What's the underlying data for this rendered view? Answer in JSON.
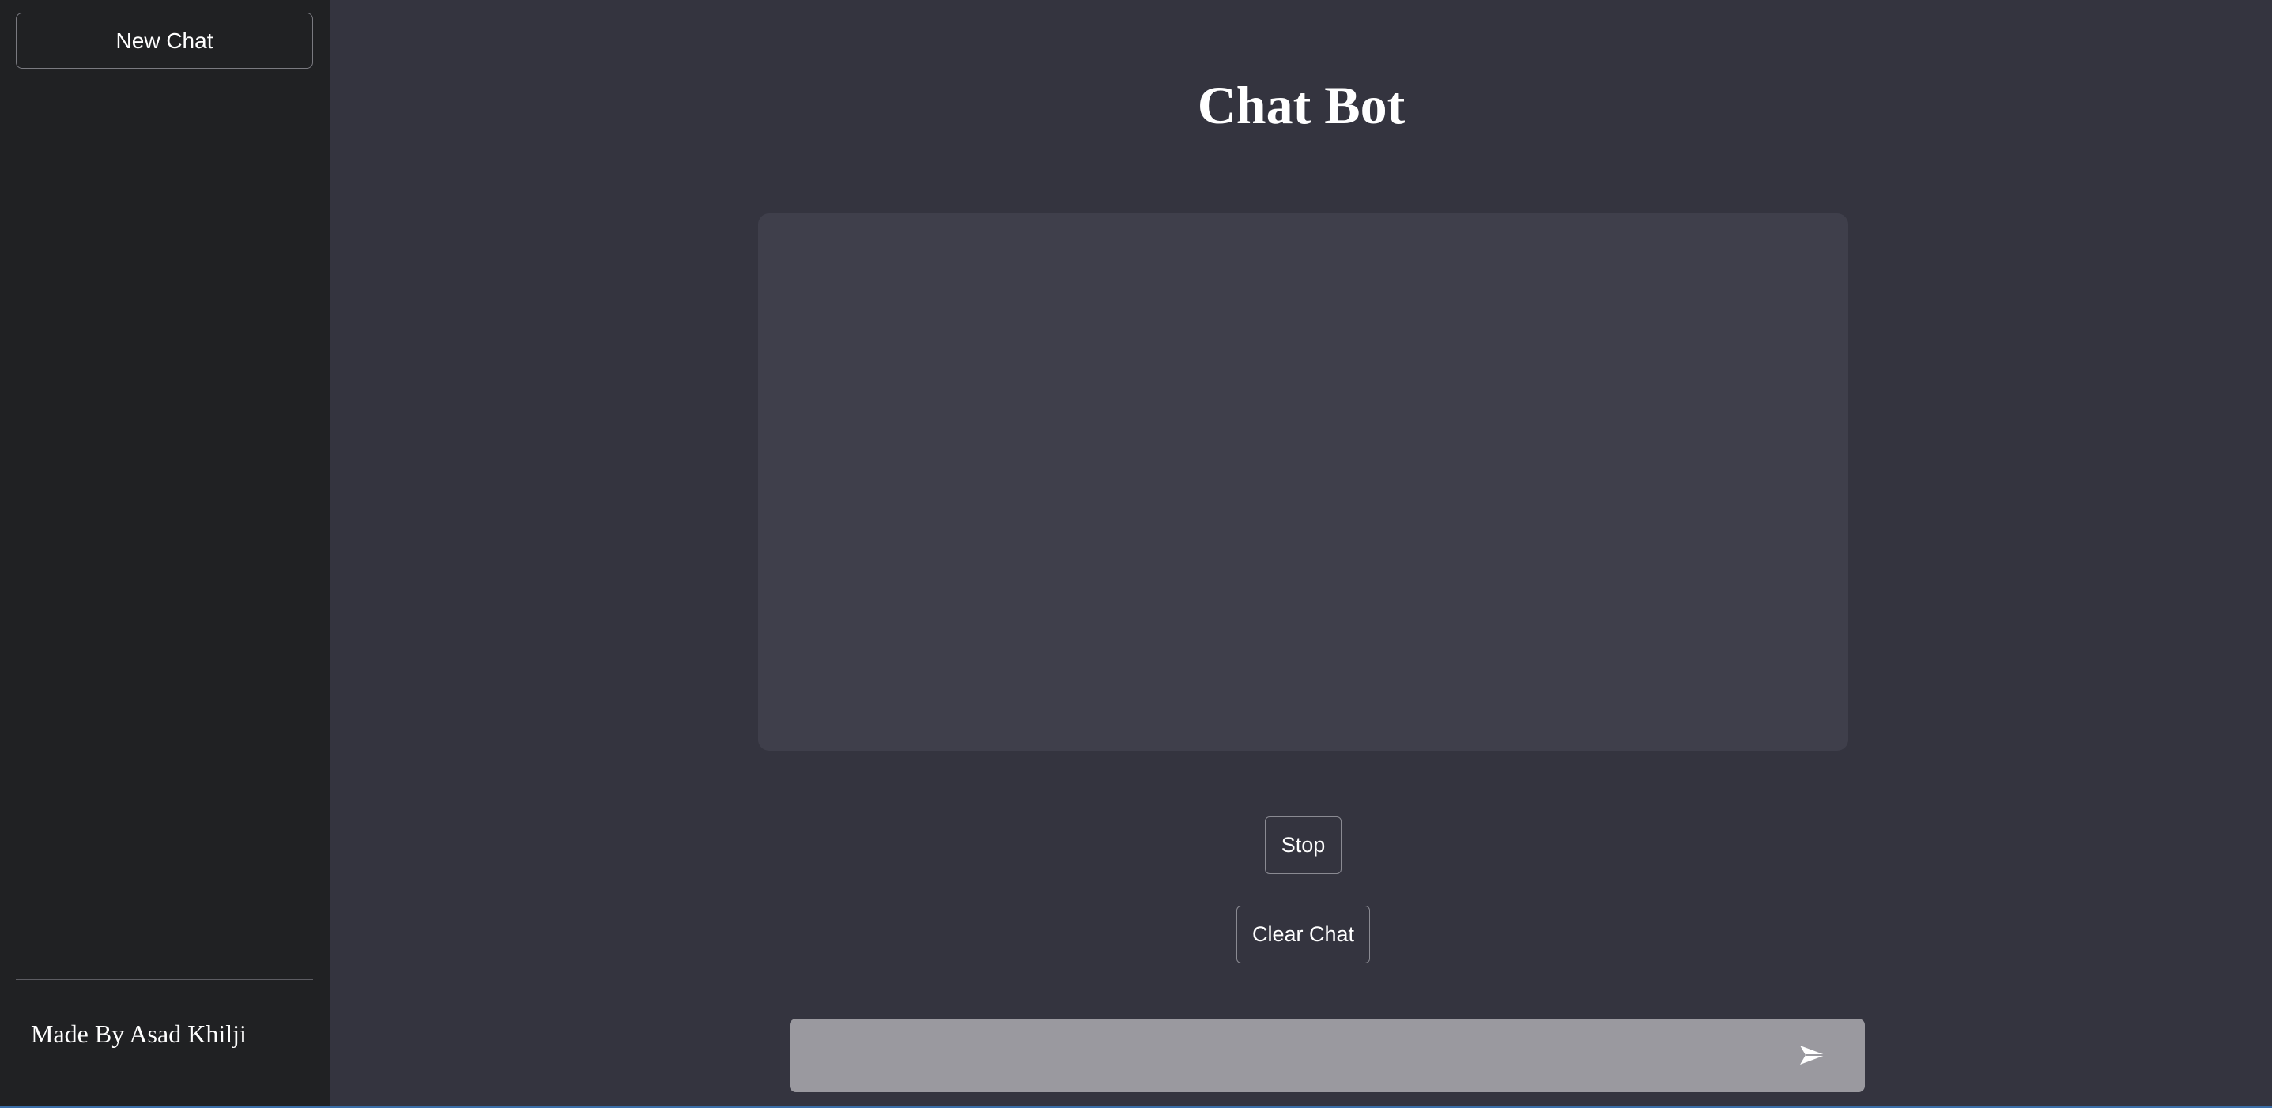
{
  "sidebar": {
    "new_chat_label": "New Chat",
    "credit": "Made By Asad Khilji"
  },
  "main": {
    "title": "Chat Bot",
    "stop_label": "Stop",
    "clear_label": "Clear Chat",
    "input": {
      "value": "",
      "placeholder": ""
    },
    "send_icon": "send-icon"
  },
  "colors": {
    "sidebar_bg": "#202123",
    "main_bg": "#34343f",
    "chat_area_bg": "#3f3f4b",
    "input_bg": "#9a999f",
    "text": "#ffffff"
  }
}
